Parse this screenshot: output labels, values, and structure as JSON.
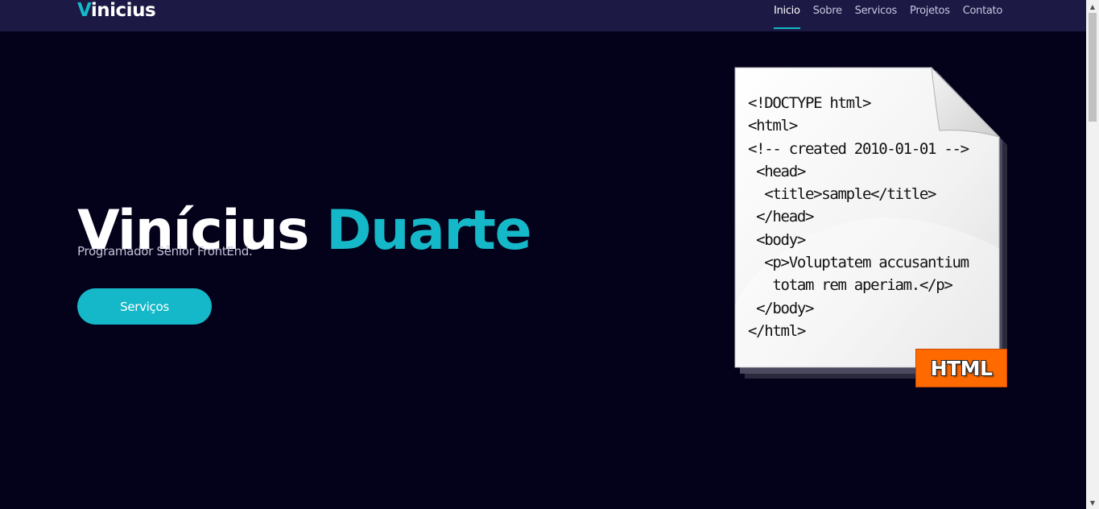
{
  "header": {
    "logo_first": "V",
    "logo_rest": "inicius",
    "nav": [
      {
        "label": "Inicio",
        "active": true
      },
      {
        "label": "Sobre"
      },
      {
        "label": "Servicos"
      },
      {
        "label": "Projetos"
      },
      {
        "label": "Contato"
      }
    ]
  },
  "hero": {
    "title_first": "Vinícius",
    "title_accent": "Duarte",
    "subtitle": "Programador Sênior FrontEnd.",
    "cta_label": "Serviços"
  },
  "illustration": {
    "code": "<!DOCTYPE html>\n<html>\n<!-- created 2010-01-01 -->\n <head>\n  <title>sample</title>\n </head>\n <body>\n  <p>Voluptatem accusantium\n   totam rem aperiam.</p>\n </body>\n</html>",
    "badge": "HTML"
  },
  "colors": {
    "accent": "#15b8c8",
    "background": "#04021a",
    "navbar": "#1c1944",
    "badge": "#ff6a00"
  },
  "icons": {
    "scroll_up": "chevron-up-icon",
    "scroll_down": "chevron-down-icon"
  }
}
